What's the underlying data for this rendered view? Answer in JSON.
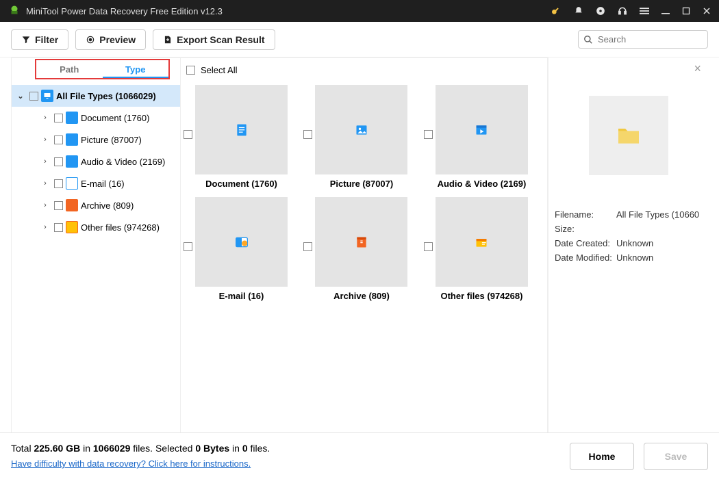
{
  "title": "MiniTool Power Data Recovery Free Edition v12.3",
  "toolbar": {
    "filter": "Filter",
    "preview": "Preview",
    "export": "Export Scan Result",
    "search_placeholder": "Search"
  },
  "tabs": {
    "path": "Path",
    "type": "Type"
  },
  "tree": {
    "root": "All File Types (1066029)",
    "items": [
      {
        "label": "Document (1760)",
        "cls": "t-doc"
      },
      {
        "label": "Picture (87007)",
        "cls": "t-pic"
      },
      {
        "label": "Audio & Video (2169)",
        "cls": "t-av"
      },
      {
        "label": "E-mail (16)",
        "cls": "t-email"
      },
      {
        "label": "Archive (809)",
        "cls": "t-archive"
      },
      {
        "label": "Other files (974268)",
        "cls": "t-other"
      }
    ]
  },
  "selectall": "Select All",
  "grid": [
    {
      "label": "Document (1760)",
      "icon": "doc"
    },
    {
      "label": "Picture (87007)",
      "icon": "pic"
    },
    {
      "label": "Audio & Video (2169)",
      "icon": "av"
    },
    {
      "label": "E-mail (16)",
      "icon": "email"
    },
    {
      "label": "Archive (809)",
      "icon": "archive"
    },
    {
      "label": "Other files (974268)",
      "icon": "other"
    }
  ],
  "details": {
    "filename_k": "Filename:",
    "filename_v": "All File Types (10660",
    "size_k": "Size:",
    "size_v": "",
    "created_k": "Date Created:",
    "created_v": "Unknown",
    "modified_k": "Date Modified:",
    "modified_v": "Unknown"
  },
  "status": {
    "total_prefix": "Total ",
    "total_size": "225.60 GB",
    "total_mid": " in ",
    "total_count": "1066029",
    "total_suffix": " files.   Selected ",
    "sel_bytes": "0 Bytes",
    "sel_mid": " in ",
    "sel_files": "0",
    "sel_suffix": " files.",
    "help": "Have difficulty with data recovery? Click here for instructions.",
    "home": "Home",
    "save": "Save"
  }
}
